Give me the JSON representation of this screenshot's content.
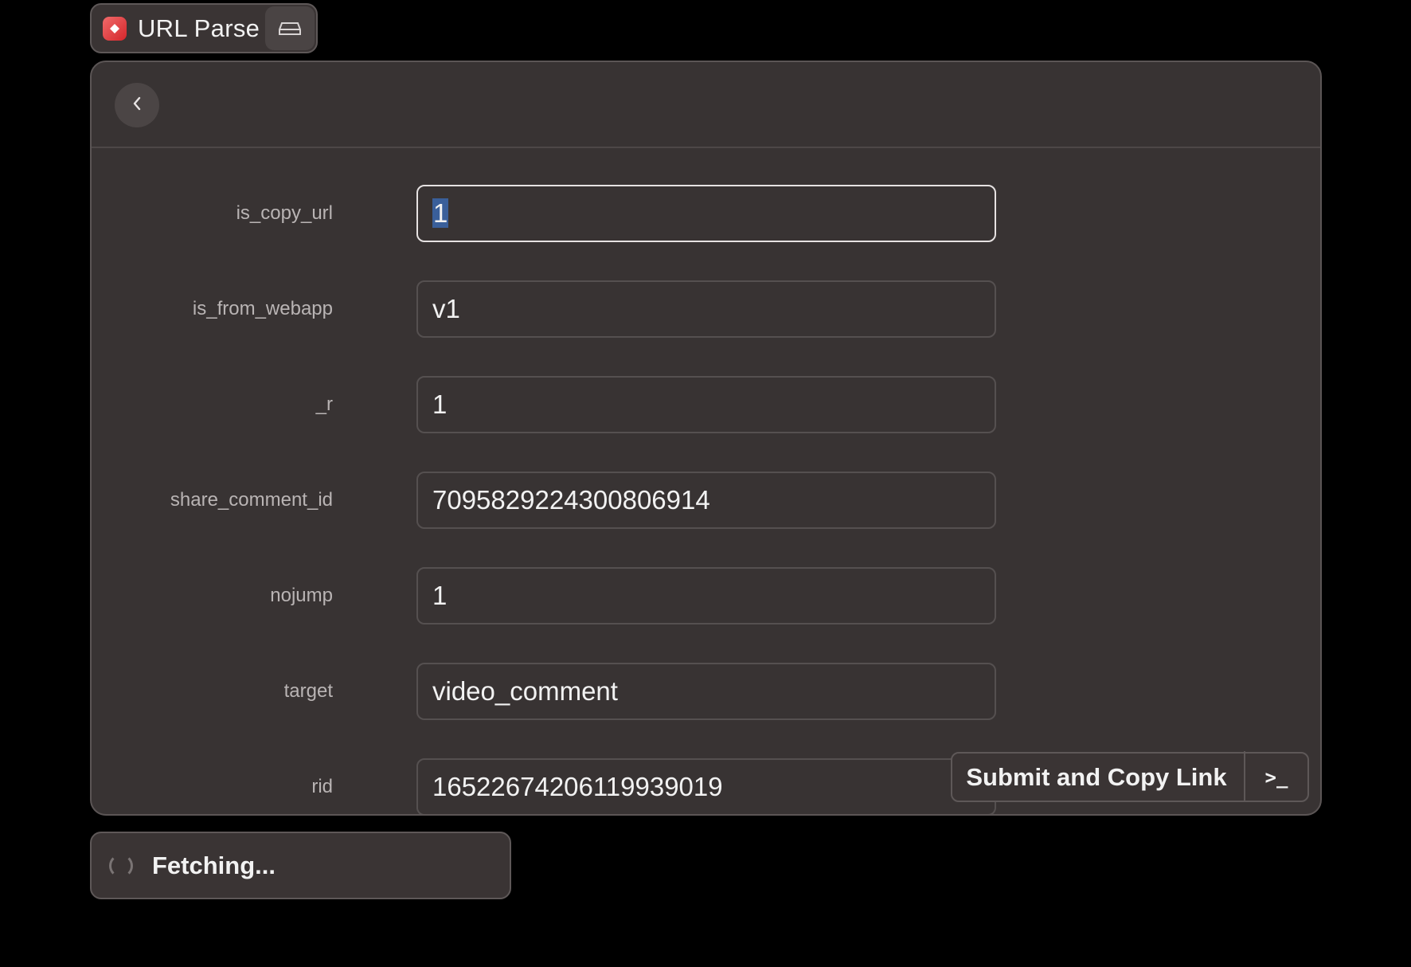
{
  "app": {
    "title": "URL Parse",
    "icon": "raycast-app-icon",
    "action_icon": "hard-drive-icon"
  },
  "header": {
    "back_icon": "chevron-left-icon"
  },
  "form": {
    "fields": [
      {
        "label": "is_copy_url",
        "value": "1",
        "focused": true
      },
      {
        "label": "is_from_webapp",
        "value": "v1"
      },
      {
        "label": "_r",
        "value": "1"
      },
      {
        "label": "share_comment_id",
        "value": "7095829224300806914"
      },
      {
        "label": "nojump",
        "value": "1"
      },
      {
        "label": "target",
        "value": "video_comment"
      },
      {
        "label": "rid",
        "value": "16522674206119939019"
      }
    ]
  },
  "action": {
    "label": "Submit and Copy Link",
    "shortcut": ">_"
  },
  "toast": {
    "text": "Fetching..."
  },
  "colors": {
    "background": "#000000",
    "panel": "#383333",
    "border": "#5b5555",
    "text": "#f2f2f2",
    "label": "#b9b4b4",
    "selection": "#3a5f9a",
    "icon_red": "#d4262b"
  }
}
